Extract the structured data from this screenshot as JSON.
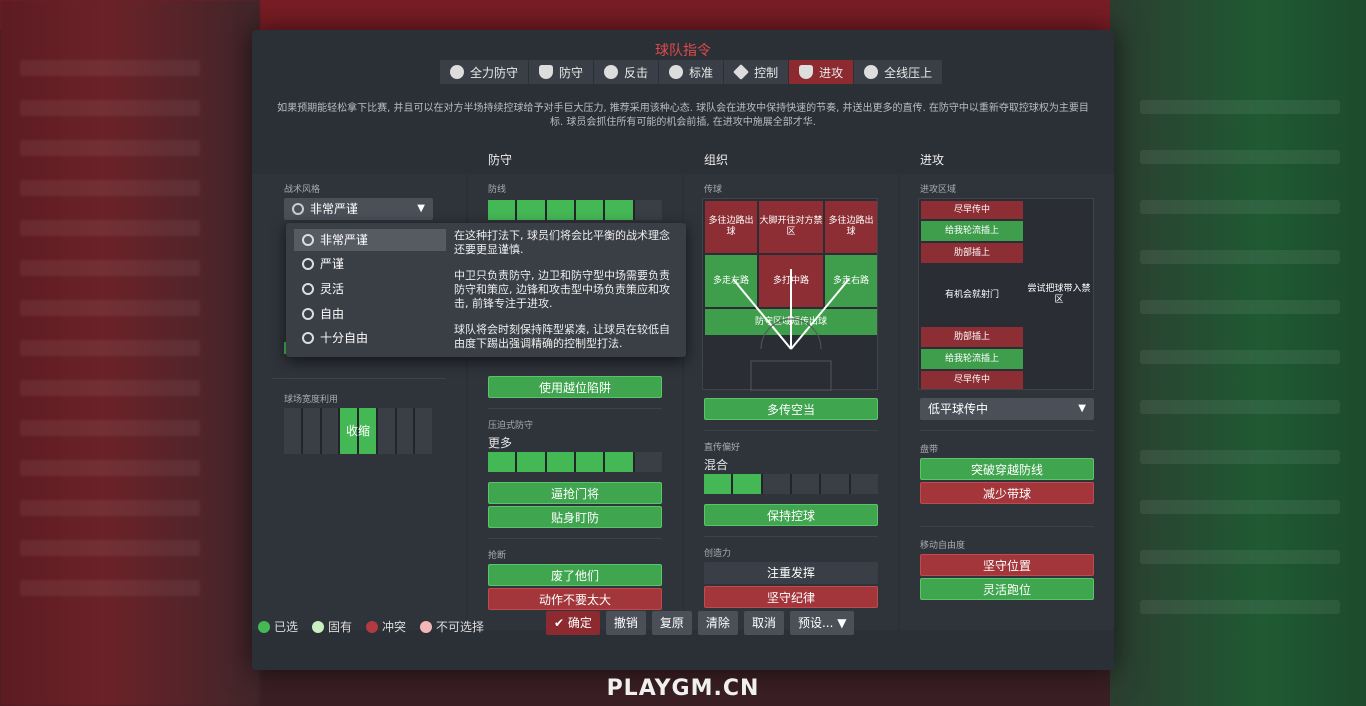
{
  "title": "球队指令",
  "tabs": [
    {
      "label": "全力防守",
      "icon": "heart-shield-icon"
    },
    {
      "label": "防守",
      "icon": "shield-icon"
    },
    {
      "label": "反击",
      "icon": "counter-icon"
    },
    {
      "label": "标准",
      "icon": "balance-icon"
    },
    {
      "label": "控制",
      "icon": "cube-icon"
    },
    {
      "label": "进攻",
      "icon": "attack-arrow-icon",
      "active": true
    },
    {
      "label": "全线压上",
      "icon": "all-out-attack-icon"
    }
  ],
  "description": "如果预期能轻松拿下比赛, 并且可以在对方半场持续控球给予对手巨大压力, 推荐采用该种心态. 球队会在进攻中保持快速的节奏, 并送出更多的直传. 在防守中以重新夺取控球权为主要目标. 球员会抓住所有可能的机会前插, 在进攻中施展全部才华.",
  "left": {
    "style_label": "战术风格",
    "style_value": "非常严谨",
    "width_label": "球场宽度利用",
    "width_value": "收缩"
  },
  "dropdown": {
    "options": [
      "非常严谨",
      "严谨",
      "灵活",
      "自由",
      "十分自由"
    ],
    "selected": 0,
    "help": [
      "在这种打法下, 球员们将会比平衡的战术理念还要更显谨慎.",
      "中卫只负责防守, 边卫和防守型中场需要负责防守和策应, 边锋和攻击型中场负责策应和攻击, 前锋专注于进攻.",
      "球队将会时刻保持阵型紧凑, 让球员在较低自由度下踢出强调精确的控制型打法."
    ]
  },
  "defense": {
    "header": "防守",
    "line_label": "防线",
    "offside_btn": "使用越位陷阱",
    "press_label": "压迫式防守",
    "press_value": "更多",
    "press_level": 0.78,
    "btn_press_gk": "逼抢门将",
    "btn_tight": "贴身盯防",
    "tackle_label": "抢断",
    "btn_get_stuck": "废了他们",
    "btn_stay_feet": "动作不要太大"
  },
  "organization": {
    "header": "组织",
    "passing_label": "传球",
    "zones": {
      "overlap_left": "多往边路出球",
      "long_ball": "大脚开往对方禁区",
      "overlap_right": "多往边路出球",
      "left": "多走左路",
      "center": "多打中路",
      "right": "多走右路",
      "play_out": "防守区域短传出球"
    },
    "btn_pass_space": "多传空当",
    "pref_label": "直传偏好",
    "pref_value": "混合",
    "btn_retain": "保持控球",
    "creativity_label": "创造力",
    "btn_expression": "注重发挥",
    "btn_discipline": "坚守纪律"
  },
  "attack": {
    "header": "进攻",
    "area_label": "进攻区域",
    "zones": {
      "early_cross_top": "尽早传中",
      "overlap_top": "给我轮流插上",
      "underlap_top": "肋部插上",
      "shoot_on_sight": "有机会就射门",
      "work_ball": "尝试把球带入禁区",
      "underlap_bottom": "肋部插上",
      "overlap_bottom": "给我轮流插上",
      "early_cross_bottom": "尽早传中"
    },
    "cross_select": "低平球传中",
    "dribble_label": "盘带",
    "btn_run_at": "突破穿越防线",
    "btn_dribble_less": "减少带球",
    "freedom_label": "移动自由度",
    "btn_hold": "坚守位置",
    "btn_roam": "灵活跑位"
  },
  "legend": [
    {
      "label": "已选",
      "color": "#45b856"
    },
    {
      "label": "固有",
      "color": "#c8f0c0"
    },
    {
      "label": "冲突",
      "color": "#b33a40"
    },
    {
      "label": "不可选择",
      "color": "#f2b8b8"
    }
  ],
  "footer": {
    "confirm": "确定",
    "undo": "撤销",
    "redo": "复原",
    "clear": "清除",
    "cancel": "取消",
    "presets": "预设..."
  },
  "watermark": "PLAYGM.CN"
}
